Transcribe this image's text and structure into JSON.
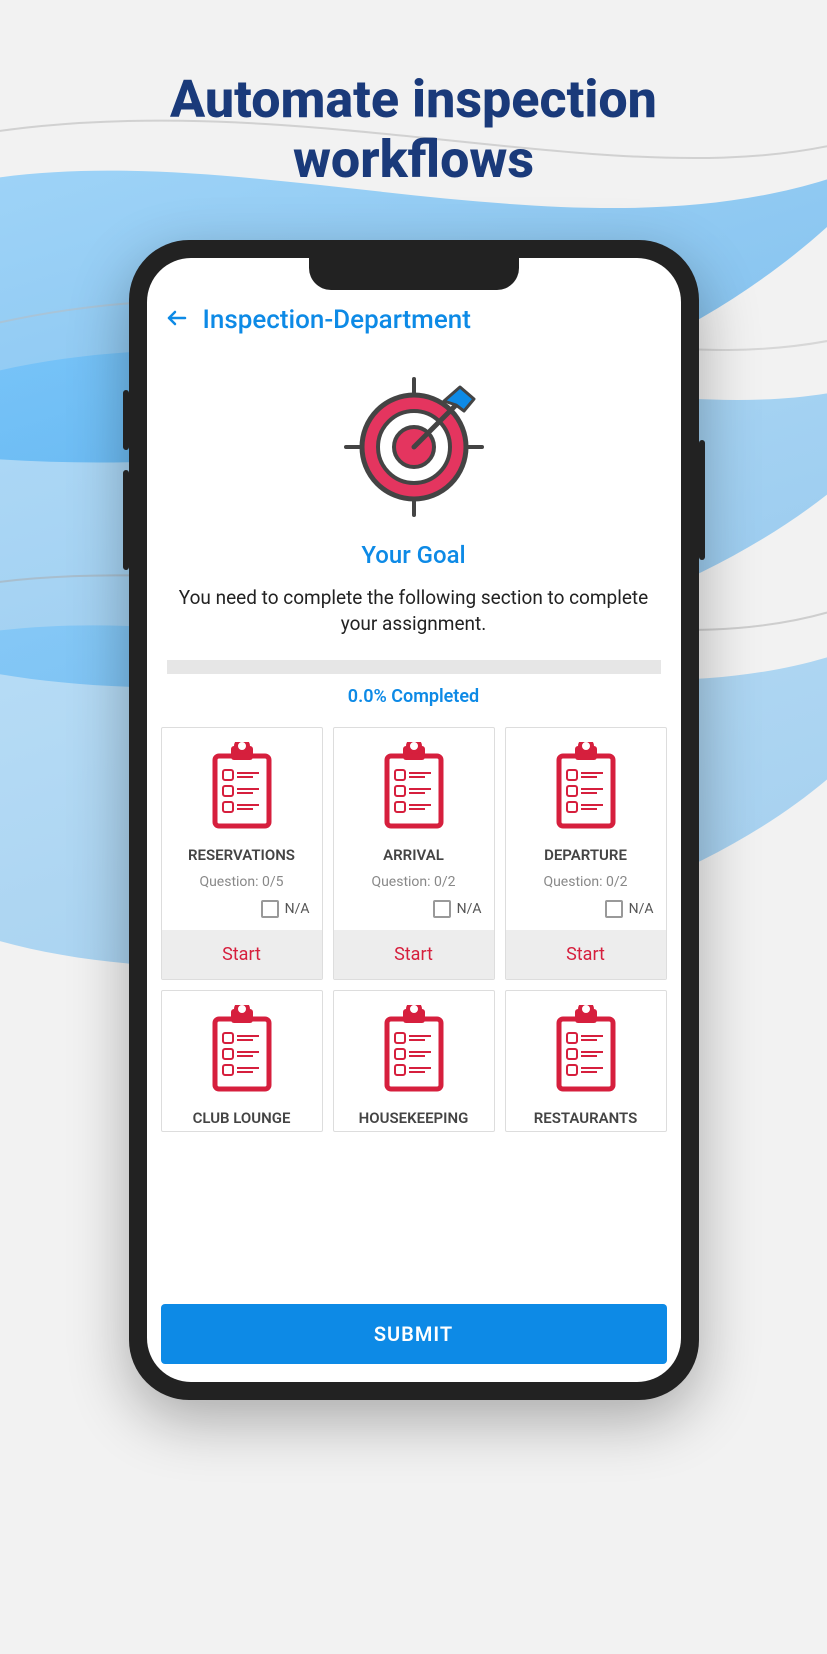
{
  "hero": {
    "title_line1": "Automate inspection",
    "title_line2": "workflows"
  },
  "app": {
    "header_title": "Inspection-Department",
    "goal_label": "Your Goal",
    "goal_desc": "You need to complete the following section to complete your assignment.",
    "progress_label": "0.0% Completed",
    "submit_label": "SUBMIT",
    "na_label": "N/A"
  },
  "cards": [
    {
      "title": "RESERVATIONS",
      "question": "Question: 0/5",
      "start": "Start",
      "full": true
    },
    {
      "title": "ARRIVAL",
      "question": "Question: 0/2",
      "start": "Start",
      "full": true
    },
    {
      "title": "DEPARTURE",
      "question": "Question: 0/2",
      "start": "Start",
      "full": true
    },
    {
      "title": "CLUB LOUNGE",
      "full": false
    },
    {
      "title": "HOUSEKEEPING",
      "full": false
    },
    {
      "title": "RESTAURANTS",
      "full": false
    }
  ]
}
